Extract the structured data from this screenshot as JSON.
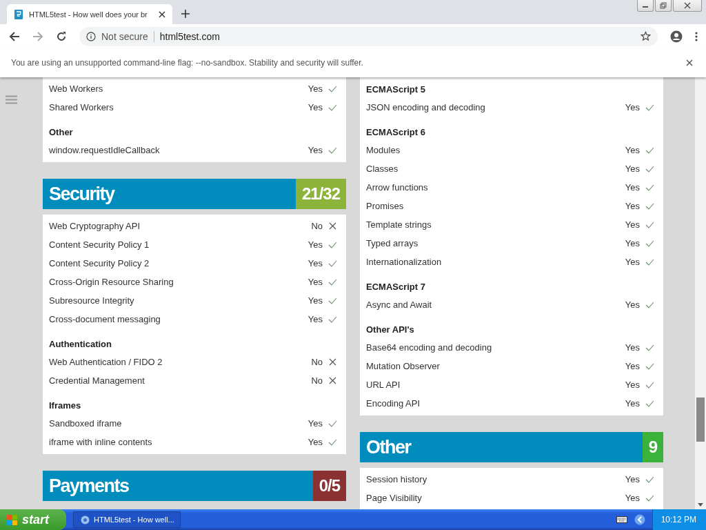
{
  "browser": {
    "tabs": [
      {
        "title": "HTML5test - How well does your br",
        "selected": true
      }
    ],
    "address": {
      "security": "Not secure",
      "url": "html5test.com"
    },
    "infobar": "You are using an unsupported command-line flag: --no-sandbox. Stability and security will suffer."
  },
  "columns": [
    {
      "blocks": [
        {
          "kind": "card",
          "groups": [
            {
              "items": [
                {
                  "label": "Web Workers",
                  "result": "Yes",
                  "passed": true
                },
                {
                  "label": "Shared Workers",
                  "result": "Yes",
                  "passed": true
                }
              ]
            },
            {
              "heading": "Other",
              "items": [
                {
                  "label": "window.requestIdleCallback",
                  "result": "Yes",
                  "passed": true
                }
              ]
            }
          ]
        },
        {
          "kind": "header",
          "title": "Security",
          "score": "21/32",
          "color": "#8cb33a"
        },
        {
          "kind": "card",
          "groups": [
            {
              "items": [
                {
                  "label": "Web Cryptography API",
                  "result": "No",
                  "passed": false
                },
                {
                  "label": "Content Security Policy 1",
                  "result": "Yes",
                  "passed": true
                },
                {
                  "label": "Content Security Policy 2",
                  "result": "Yes",
                  "passed": true
                },
                {
                  "label": "Cross-Origin Resource Sharing",
                  "result": "Yes",
                  "passed": true
                },
                {
                  "label": "Subresource Integrity",
                  "result": "Yes",
                  "passed": true
                },
                {
                  "label": "Cross-document messaging",
                  "result": "Yes",
                  "passed": true
                }
              ]
            },
            {
              "heading": "Authentication",
              "items": [
                {
                  "label": "Web Authentication / FIDO 2",
                  "result": "No",
                  "passed": false
                },
                {
                  "label": "Credential Management",
                  "result": "No",
                  "passed": false
                }
              ]
            },
            {
              "heading": "Iframes",
              "items": [
                {
                  "label": "Sandboxed iframe",
                  "result": "Yes",
                  "passed": true
                },
                {
                  "label": "iframe with inline contents",
                  "result": "Yes",
                  "passed": true
                }
              ]
            }
          ]
        },
        {
          "kind": "header",
          "title": "Payments",
          "score": "0/5",
          "color": "#8b3131"
        }
      ]
    },
    {
      "blocks": [
        {
          "kind": "card",
          "groups": [
            {
              "heading": "ECMAScript 5",
              "items": [
                {
                  "label": "JSON encoding and decoding",
                  "result": "Yes",
                  "passed": true
                }
              ]
            },
            {
              "heading": "ECMAScript 6",
              "items": [
                {
                  "label": "Modules",
                  "result": "Yes",
                  "passed": true
                },
                {
                  "label": "Classes",
                  "result": "Yes",
                  "passed": true
                },
                {
                  "label": "Arrow functions",
                  "result": "Yes",
                  "passed": true
                },
                {
                  "label": "Promises",
                  "result": "Yes",
                  "passed": true
                },
                {
                  "label": "Template strings",
                  "result": "Yes",
                  "passed": true
                },
                {
                  "label": "Typed arrays",
                  "result": "Yes",
                  "passed": true
                },
                {
                  "label": "Internationalization",
                  "result": "Yes",
                  "passed": true
                }
              ]
            },
            {
              "heading": "ECMAScript 7",
              "items": [
                {
                  "label": "Async and Await",
                  "result": "Yes",
                  "passed": true
                }
              ]
            },
            {
              "heading": "Other API's",
              "items": [
                {
                  "label": "Base64 encoding and decoding",
                  "result": "Yes",
                  "passed": true
                },
                {
                  "label": "Mutation Observer",
                  "result": "Yes",
                  "passed": true
                },
                {
                  "label": "URL API",
                  "result": "Yes",
                  "passed": true
                },
                {
                  "label": "Encoding API",
                  "result": "Yes",
                  "passed": true
                }
              ]
            }
          ]
        },
        {
          "kind": "header",
          "title": "Other",
          "score": "9",
          "color": "#3bb33b"
        },
        {
          "kind": "card",
          "groups": [
            {
              "items": [
                {
                  "label": "Session history",
                  "result": "Yes",
                  "passed": true
                },
                {
                  "label": "Page Visibility",
                  "result": "Yes",
                  "passed": true
                }
              ]
            }
          ]
        }
      ]
    }
  ],
  "taskbar": {
    "start": "start",
    "task": "HTML5test - How well...",
    "time": "10:12 PM"
  }
}
